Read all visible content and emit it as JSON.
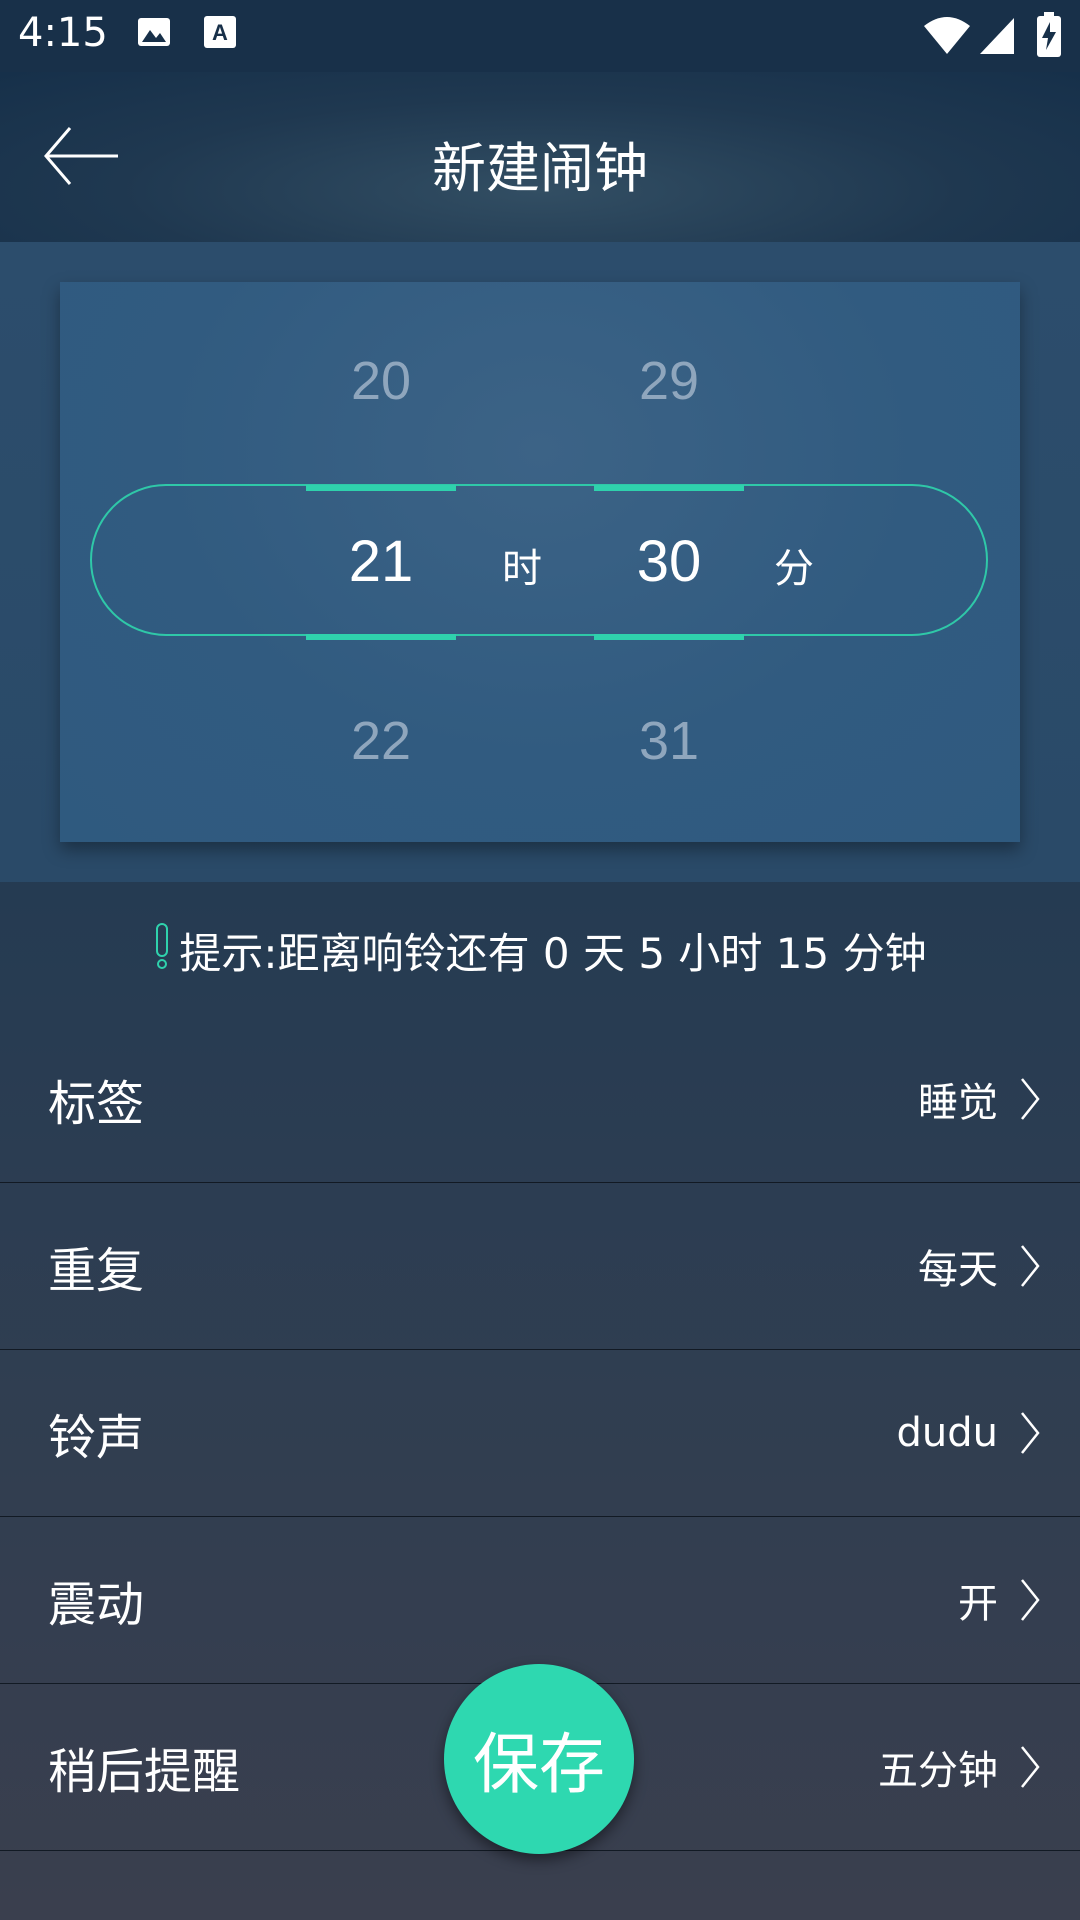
{
  "status_bar": {
    "time": "4:15",
    "icons": [
      "image-icon",
      "text-a-icon",
      "wifi-icon",
      "signal-icon",
      "battery-charging-icon"
    ]
  },
  "header": {
    "title": "新建闹钟",
    "back_icon": "back-arrow-icon"
  },
  "picker": {
    "hour": {
      "prev": "20",
      "selected": "21",
      "next": "22",
      "unit": "时"
    },
    "minute": {
      "prev": "29",
      "selected": "30",
      "next": "31",
      "unit": "分"
    },
    "accent_color": "#2fd2ad"
  },
  "hint": {
    "text": "提示:距离响铃还有 0 天 5 小时 15 分钟",
    "icon": "exclamation-icon"
  },
  "settings": [
    {
      "label": "标签",
      "value": "睡觉"
    },
    {
      "label": "重复",
      "value": "每天"
    },
    {
      "label": "铃声",
      "value": "dudu"
    },
    {
      "label": "震动",
      "value": "开"
    },
    {
      "label": "稍后提醒",
      "value": "五分钟"
    }
  ],
  "save_button": {
    "label": "保存",
    "color": "#2ed8b0"
  }
}
